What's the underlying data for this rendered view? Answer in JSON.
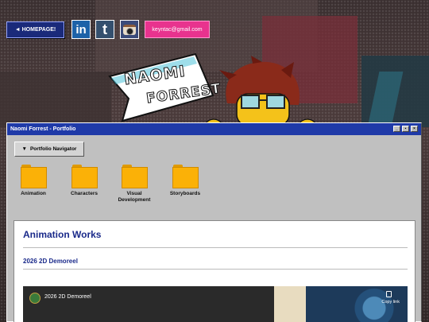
{
  "topbar": {
    "homepage_label": "◄ HOMEPAGE!",
    "social": [
      {
        "name": "linkedin-icon",
        "glyph": "in"
      },
      {
        "name": "tumblr-icon",
        "glyph": "t"
      },
      {
        "name": "instagram-icon",
        "glyph": ""
      }
    ],
    "email_label": "keyntac@gmail.com"
  },
  "logo": {
    "first": "NAOMI",
    "last": "FORREST"
  },
  "window": {
    "title": "Naomi Forrest - Portfolio",
    "controls": [
      "_",
      "▪",
      "×"
    ],
    "nav_button": "Portfolio Navigator",
    "nav_arrow": "▼",
    "folders": [
      {
        "label": "Animation"
      },
      {
        "label": "Characters"
      },
      {
        "label": "Visual Development"
      },
      {
        "label": "Storyboards"
      }
    ]
  },
  "content": {
    "section_title": "Animation Works",
    "sub_title": "2026 2D Demoreel",
    "video": {
      "title": "2026 2D Demoreel",
      "copy_label": "Copy link"
    }
  },
  "colors": {
    "titlebar": "#1f3aa8",
    "heading": "#1a2a8a",
    "email": "#e8338e",
    "folder": "#fbb107"
  }
}
